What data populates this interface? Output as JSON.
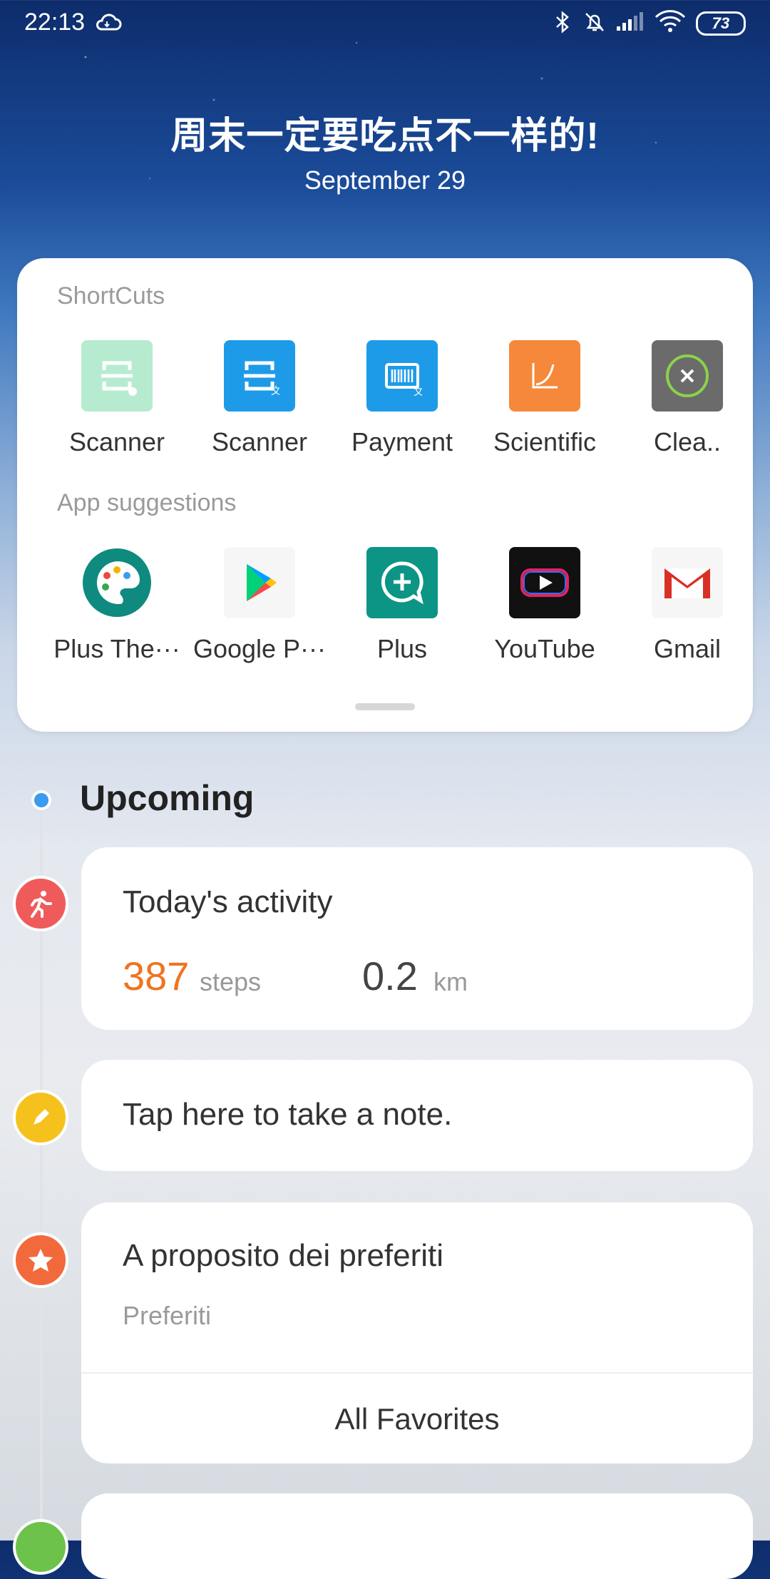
{
  "status_bar": {
    "time": "22:13",
    "battery": "73"
  },
  "hero": {
    "title": "周末一定要吃点不一样的!",
    "date": "September 29"
  },
  "shortcuts": {
    "label": "ShortCuts",
    "items": [
      {
        "label": "Scanner",
        "icon": "scanner-icon"
      },
      {
        "label": "Scanner",
        "icon": "scanner-translate-icon"
      },
      {
        "label": "Payment",
        "icon": "barcode-payment-icon"
      },
      {
        "label": "Scientific",
        "icon": "scientific-calculator-icon"
      },
      {
        "label": "Clea..",
        "icon": "cleaner-icon"
      }
    ]
  },
  "suggestions": {
    "label": "App suggestions",
    "items": [
      {
        "label": "Plus The···",
        "icon": "palette-icon"
      },
      {
        "label": "Google P···",
        "icon": "play-store-icon"
      },
      {
        "label": "Plus",
        "icon": "plus-chat-icon"
      },
      {
        "label": "YouTube",
        "icon": "youtube-icon"
      },
      {
        "label": "Gmail",
        "icon": "gmail-icon"
      }
    ]
  },
  "timeline": {
    "heading": "Upcoming",
    "activity": {
      "title": "Today's activity",
      "steps": "387",
      "steps_unit": "steps",
      "distance": "0.2",
      "distance_unit": "km"
    },
    "note": {
      "text": "Tap here to take a note."
    },
    "favorites": {
      "title": "A proposito dei preferiti",
      "subtitle": "Preferiti",
      "button": "All Favorites"
    }
  },
  "colors": {
    "accent_orange": "#f07320",
    "timeline_blue": "#3a9bf0",
    "activity_red": "#ef5b5b",
    "note_yellow": "#f5c21d",
    "favorite_orange": "#f26a3c",
    "next_green": "#6cc24a"
  }
}
